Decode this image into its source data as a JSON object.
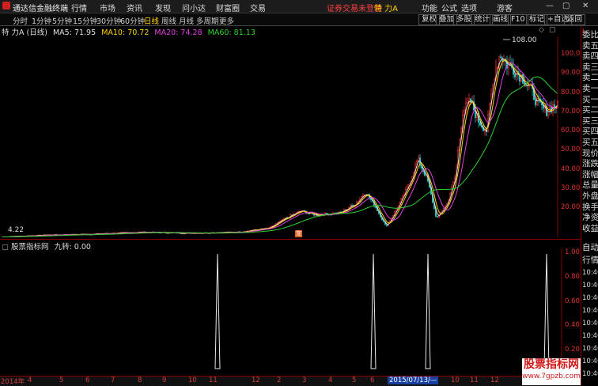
{
  "titlebar": {
    "app_name": "通达信金融终端",
    "menus": [
      "行情",
      "市场",
      "资讯",
      "发现",
      "问小达",
      "财富圈",
      "交易"
    ],
    "login_status": "证券交易未登录",
    "stock_name": "特 力A",
    "right_menus": [
      "功能",
      "公式",
      "选项",
      "游客"
    ]
  },
  "toolbar": {
    "timeframes": [
      "分时",
      "1分钟",
      "5分钟",
      "15分钟",
      "30分钟",
      "60分钟",
      "日线",
      "周线",
      "月线",
      "多周期",
      "更多"
    ],
    "active_timeframe": "日线",
    "right_buttons": [
      "复权",
      "叠加",
      "多股",
      "统计",
      "画线",
      "F10",
      "标记",
      "+自选",
      "返回"
    ]
  },
  "chart_header": {
    "title": "特 力A (日线)",
    "ma": [
      {
        "label": "MA5: 71.95",
        "color": "#e0e0e0"
      },
      {
        "label": "MA10: 70.72",
        "color": "#ffd200"
      },
      {
        "label": "MA20: 74.28",
        "color": "#e040e0"
      },
      {
        "label": "MA60: 81.13",
        "color": "#30d030"
      }
    ]
  },
  "indicator_header": {
    "name": "股票指标网",
    "value": "九转: 0.00"
  },
  "price_axis": [
    "100.0",
    "90.00",
    "80.00",
    "70.00",
    "60.00",
    "50.00",
    "40.00",
    "30.00",
    "20.00"
  ],
  "price_annotations": {
    "high": "108.00",
    "low": "4.22"
  },
  "indicator_axis": [
    "1.00",
    "0.80",
    "0.60",
    "0.40",
    "0.20"
  ],
  "right_panel": {
    "top_label": "L",
    "labels": [
      "委比",
      "卖五",
      "卖四",
      "卖三",
      "卖二",
      "卖一",
      "买一",
      "买二",
      "买三",
      "买四",
      "买五",
      "现价",
      "涨跌",
      "涨幅",
      "总量",
      "外盘",
      "换手",
      "净资",
      "收益"
    ],
    "bottom_labels": [
      "自动",
      "行情",
      "10:40",
      "10:40",
      "10:40",
      "10:40",
      "10:40",
      "10:40",
      "10:40",
      "10:40",
      "10:40"
    ]
  },
  "time_axis": {
    "year": "2014年",
    "months": [
      "4",
      "5",
      "6",
      "7",
      "8",
      "9",
      "10",
      "11",
      "12",
      "2",
      "3",
      "4",
      "5",
      "6",
      "7",
      "8",
      "9",
      "10",
      "11",
      "12"
    ],
    "highlight_date": "2015/07/13/—"
  },
  "watermark": {
    "line1": "股票指标网",
    "line2": "www.7gpzb.com"
  },
  "colors": {
    "price_axis": "#e03030",
    "ma5": "#e0e0e0",
    "ma10": "#ffd200",
    "ma20": "#e040e0",
    "ma60": "#30d030",
    "up": "#ff3030",
    "down": "#30c0c0"
  }
}
